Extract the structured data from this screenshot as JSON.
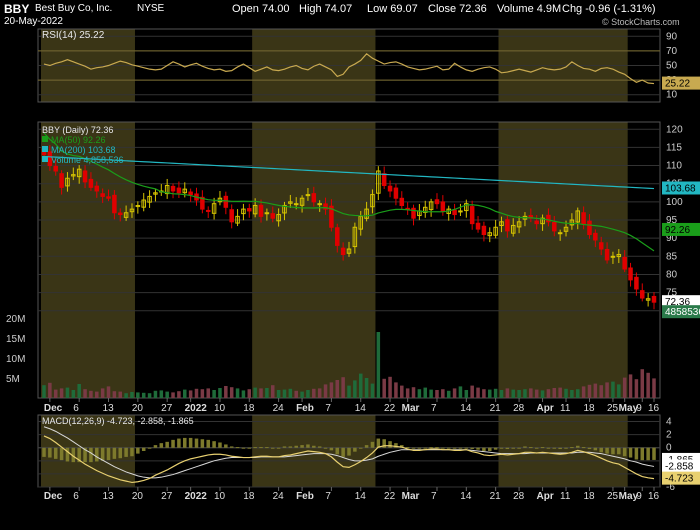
{
  "header": {
    "ticker": "BBY",
    "company": "Best Buy Co, Inc.",
    "exchange": "NYSE",
    "date": "20-May-2022",
    "open": "Open 74.00",
    "high": "High 74.07",
    "low": "Low 69.07",
    "close": "Close 72.36",
    "volume": "Volume 4.9M",
    "chg": "Chg -0.96 (-1.31%)",
    "watermark": "© StockCharts.com"
  },
  "colors": {
    "up": "#d6c400",
    "down": "#e00000",
    "ma50": "#1a9e1a",
    "ma200": "#22b7c2",
    "rsi": "#c8a950",
    "macd": "#e8d070",
    "signal": "#d8d8d8",
    "histogram": "#7d7a2c",
    "shade": "#3a3516"
  },
  "chart_data": [
    {
      "type": "line",
      "title": "RSI(14) 25.22",
      "indicator": "RSI",
      "period": 14,
      "last": 25.22,
      "ylim": [
        0,
        100
      ],
      "yticks": [
        10,
        30,
        50,
        70,
        90
      ],
      "bands": [
        30,
        70
      ],
      "values": [
        52,
        50,
        53,
        55,
        58,
        55,
        52,
        49,
        45,
        47,
        48,
        50,
        53,
        56,
        54,
        51,
        49,
        47,
        45,
        44,
        45,
        50,
        55,
        52,
        48,
        51,
        53,
        49,
        46,
        44,
        45,
        42,
        43,
        48,
        52,
        47,
        42,
        45,
        48,
        44,
        43,
        45,
        48,
        50,
        46,
        44,
        49,
        52,
        48,
        44,
        35,
        38,
        48,
        52,
        57,
        66,
        60,
        56,
        52,
        54,
        55,
        52,
        48,
        46,
        44,
        45,
        47,
        49,
        44,
        45,
        53,
        48,
        44,
        42,
        45,
        47,
        48,
        45,
        40,
        41,
        43,
        45,
        43,
        41,
        44,
        47,
        45,
        44,
        45,
        48,
        55,
        50,
        46,
        45,
        42,
        46,
        47,
        45,
        41,
        38,
        32,
        27,
        30,
        26,
        25.22
      ]
    },
    {
      "type": "candlestick",
      "title": "BBY (Daily) 72.36",
      "ylim": [
        68,
        122
      ],
      "yticks": [
        70,
        75,
        80,
        85,
        90,
        95,
        100,
        105,
        110,
        115,
        120
      ],
      "x_labels": [
        "Dec",
        "6",
        "13",
        "20",
        "27",
        "2022",
        "10",
        "18",
        "24",
        "Feb",
        "7",
        "14",
        "22",
        "Mar",
        "7",
        "14",
        "21",
        "28",
        "Apr",
        "11",
        "18",
        "25",
        "May",
        "9",
        "16"
      ],
      "close": [
        113.0,
        110.0,
        108.5,
        104.0,
        106.5,
        107.5,
        109.0,
        105.5,
        104.0,
        103.0,
        101.5,
        101.0,
        97.0,
        96.5,
        97.0,
        98.0,
        99.0,
        100.5,
        101.5,
        102.5,
        103.0,
        104.5,
        103.0,
        102.5,
        103.5,
        102.0,
        100.5,
        98.0,
        97.5,
        99.5,
        101.0,
        98.5,
        94.5,
        96.0,
        98.0,
        97.5,
        99.0,
        96.0,
        97.0,
        95.5,
        96.5,
        99.0,
        100.0,
        99.5,
        101.0,
        102.0,
        100.0,
        99.5,
        98.0,
        93.0,
        88.0,
        85.5,
        87.0,
        93.0,
        96.0,
        98.0,
        102.0,
        108.5,
        104.5,
        103.0,
        101.0,
        99.0,
        98.0,
        95.5,
        97.5,
        98.5,
        100.0,
        99.5,
        97.5,
        98.0,
        96.5,
        97.5,
        99.5,
        94.0,
        92.5,
        91.0,
        91.5,
        93.0,
        94.5,
        92.0,
        93.5,
        94.5,
        96.0,
        95.5,
        94.0,
        95.5,
        94.5,
        92.0,
        91.5,
        93.0,
        95.0,
        97.5,
        94.0,
        91.0,
        89.5,
        87.0,
        84.0,
        85.0,
        85.5,
        81.5,
        78.5,
        76.0,
        73.5,
        73.32,
        72.36
      ],
      "series": [
        {
          "name": "MA(50) 92.26",
          "last": 92.26
        },
        {
          "name": "MA(200) 103.68",
          "last": 103.68
        },
        {
          "name": "Volume 4,858,536",
          "last": 4858536
        }
      ],
      "price_labels": [
        "72.36",
        "4858536"
      ],
      "ma_labels": [
        "103.68",
        "92.26"
      ]
    },
    {
      "type": "bar",
      "title": "Volume",
      "ylim": [
        0,
        20
      ],
      "yticks_label": [
        "5M",
        "10M",
        "15M",
        "20M"
      ],
      "yticks": [
        5,
        10,
        15,
        20
      ],
      "values_millions": [
        3.2,
        3.8,
        2.1,
        2.4,
        2.6,
        2.0,
        3.5,
        2.2,
        1.8,
        1.6,
        2.4,
        2.9,
        1.7,
        1.6,
        1.2,
        1.5,
        1.4,
        1.3,
        1.2,
        1.8,
        1.9,
        1.6,
        1.4,
        1.7,
        2.1,
        1.9,
        2.3,
        2.2,
        2.4,
        2.0,
        2.5,
        3.0,
        2.7,
        2.4,
        1.9,
        2.2,
        2.6,
        2.4,
        2.5,
        3.2,
        2.0,
        2.1,
        2.3,
        1.8,
        1.6,
        2.0,
        2.3,
        2.4,
        3.4,
        3.9,
        4.5,
        5.2,
        3.1,
        4.4,
        6.1,
        5.0,
        3.6,
        16.5,
        4.8,
        5.3,
        3.9,
        3.1,
        2.4,
        2.7,
        2.2,
        2.6,
        2.1,
        2.0,
        2.2,
        1.8,
        2.4,
        2.9,
        2.0,
        3.1,
        2.6,
        2.2,
        2.1,
        2.3,
        2.0,
        2.4,
        2.1,
        2.0,
        2.2,
        2.4,
        2.1,
        1.9,
        2.2,
        2.5,
        2.6,
        2.3,
        2.0,
        2.2,
        2.9,
        3.3,
        3.6,
        3.2,
        3.9,
        4.1,
        3.4,
        5.1,
        5.9,
        4.7,
        7.2,
        6.3,
        4.9
      ]
    },
    {
      "type": "line",
      "title": "MACD(12,26,9) -4.723, -2.858, -1.865",
      "ylim": [
        -6,
        5
      ],
      "yticks": [
        -6,
        -4,
        -2,
        0,
        2,
        4
      ],
      "series": [
        {
          "name": "MACD",
          "last": -4.723
        },
        {
          "name": "Signal",
          "last": -2.858
        },
        {
          "name": "Histogram",
          "last": -1.865
        }
      ],
      "macd": [
        1.8,
        1.4,
        0.8,
        0.1,
        -0.6,
        -1.3,
        -1.9,
        -2.5,
        -3.0,
        -3.5,
        -3.9,
        -4.3,
        -4.6,
        -4.9,
        -5.1,
        -5.3,
        -5.2,
        -5.0,
        -4.7,
        -4.2,
        -3.8,
        -3.4,
        -2.9,
        -2.4,
        -2.0,
        -1.7,
        -1.5,
        -1.3,
        -1.1,
        -1.0,
        -1.0,
        -1.1,
        -1.3,
        -1.4,
        -1.5,
        -1.5,
        -1.4,
        -1.3,
        -1.3,
        -1.4,
        -1.4,
        -1.2,
        -1.1,
        -0.9,
        -0.7,
        -0.5,
        -0.6,
        -0.7,
        -0.9,
        -1.4,
        -2.2,
        -2.9,
        -3.0,
        -2.6,
        -2.1,
        -1.5,
        -0.8,
        0.1,
        0.3,
        0.3,
        0.2,
        0.1,
        -0.2,
        -0.4,
        -0.4,
        -0.3,
        -0.2,
        -0.2,
        -0.3,
        -0.3,
        -0.4,
        -0.4,
        -0.3,
        -0.6,
        -0.8,
        -1.1,
        -1.2,
        -1.1,
        -1.0,
        -1.1,
        -1.0,
        -0.9,
        -0.7,
        -0.7,
        -0.8,
        -0.7,
        -0.8,
        -0.9,
        -1.0,
        -0.9,
        -0.7,
        -0.4,
        -0.6,
        -0.9,
        -1.2,
        -1.6,
        -2.0,
        -2.3,
        -2.5,
        -3.0,
        -3.5,
        -4.0,
        -4.4,
        -4.6,
        -4.723
      ],
      "signal": [
        3.2,
        2.9,
        2.5,
        2.0,
        1.5,
        0.9,
        0.3,
        -0.3,
        -0.8,
        -1.4,
        -1.9,
        -2.4,
        -2.9,
        -3.3,
        -3.7,
        -4.0,
        -4.3,
        -4.5,
        -4.6,
        -4.6,
        -4.5,
        -4.3,
        -4.1,
        -3.8,
        -3.5,
        -3.2,
        -2.9,
        -2.6,
        -2.3,
        -2.0,
        -1.8,
        -1.6,
        -1.5,
        -1.5,
        -1.5,
        -1.5,
        -1.5,
        -1.4,
        -1.4,
        -1.4,
        -1.4,
        -1.4,
        -1.3,
        -1.2,
        -1.1,
        -1.0,
        -0.9,
        -0.9,
        -0.9,
        -1.0,
        -1.2,
        -1.5,
        -1.8,
        -2.0,
        -2.0,
        -1.9,
        -1.7,
        -1.3,
        -1.0,
        -0.7,
        -0.5,
        -0.3,
        -0.3,
        -0.3,
        -0.3,
        -0.3,
        -0.3,
        -0.3,
        -0.3,
        -0.3,
        -0.3,
        -0.3,
        -0.3,
        -0.4,
        -0.5,
        -0.6,
        -0.7,
        -0.8,
        -0.9,
        -0.9,
        -0.9,
        -0.9,
        -0.9,
        -0.8,
        -0.8,
        -0.8,
        -0.8,
        -0.8,
        -0.8,
        -0.8,
        -0.8,
        -0.7,
        -0.7,
        -0.7,
        -0.8,
        -0.9,
        -1.1,
        -1.3,
        -1.5,
        -1.7,
        -2.0,
        -2.2,
        -2.5,
        -2.7,
        -2.858
      ]
    }
  ]
}
